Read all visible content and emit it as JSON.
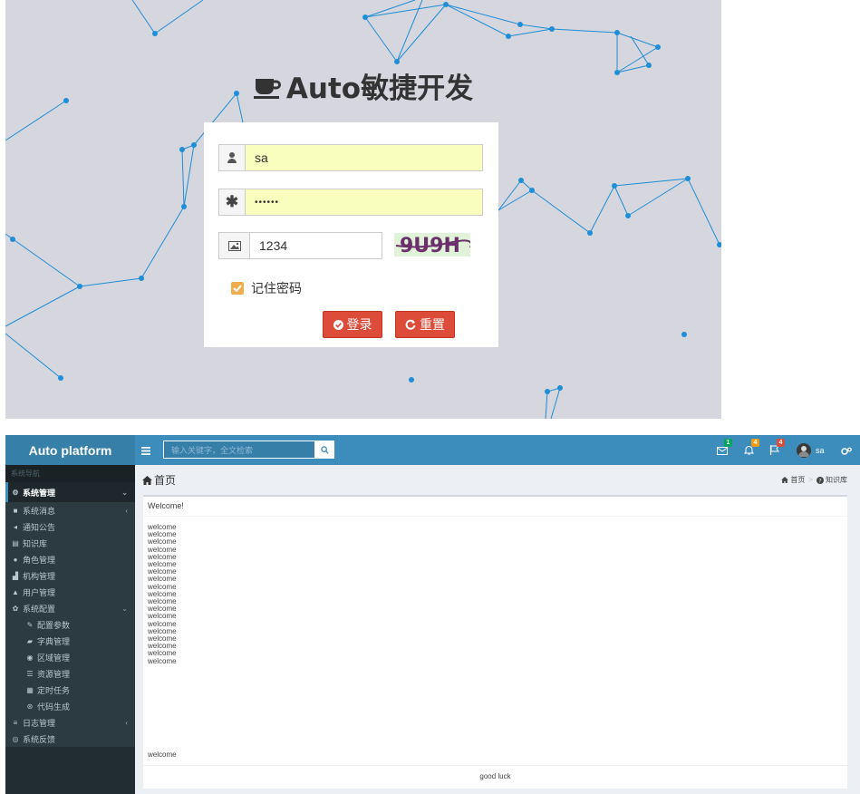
{
  "login": {
    "title": "Auto敏捷开发",
    "username_value": "sa",
    "password_value": "••••••",
    "captcha_input_value": "1234",
    "captcha_image_text": "9U9H",
    "remember_label": "记住密码",
    "login_button": "登录",
    "reset_button": "重置"
  },
  "admin": {
    "logo": "Auto platform",
    "search_placeholder": "输入关键字，全文检索",
    "header_badges": {
      "messages": "1",
      "notifications": "4",
      "tasks": "4"
    },
    "user_name": "sa",
    "sidebar": {
      "header": "系统导航",
      "items": [
        {
          "label": "系统管理",
          "icon": "cogs-icon",
          "active": true,
          "arrow": "⌄"
        },
        {
          "label": "系统消息",
          "icon": "folder-icon",
          "arrow": "‹"
        },
        {
          "label": "通知公告",
          "icon": "bullhorn-icon"
        },
        {
          "label": "知识库",
          "icon": "book-icon"
        },
        {
          "label": "角色管理",
          "icon": "users-icon"
        },
        {
          "label": "机构管理",
          "icon": "sitemap-icon"
        },
        {
          "label": "用户管理",
          "icon": "user-icon"
        },
        {
          "label": "系统配置",
          "icon": "gear-icon",
          "arrow": "⌄"
        },
        {
          "label": "配置参数",
          "icon": "wrench-icon"
        },
        {
          "label": "字典管理",
          "icon": "book-icon"
        },
        {
          "label": "区域管理",
          "icon": "globe-icon"
        },
        {
          "label": "资源管理",
          "icon": "list-icon"
        },
        {
          "label": "定时任务",
          "icon": "tasks-icon"
        },
        {
          "label": "代码生成",
          "icon": "code-icon"
        },
        {
          "label": "日志管理",
          "icon": "bars-icon",
          "arrow": "‹"
        },
        {
          "label": "系统反馈",
          "icon": "eye-icon"
        }
      ]
    },
    "page_title": "首页",
    "breadcrumb": {
      "home": "首页",
      "sep": ">",
      "current": "知识库"
    },
    "box_title": "Welcome!",
    "welcome_lines": [
      "welcome",
      "welcome",
      "welcome",
      "welcome",
      "welcome",
      "welcome",
      "welcome",
      "welcome",
      "welcome",
      "welcome",
      "welcome",
      "welcome",
      "welcome",
      "welcome",
      "welcome",
      "welcome",
      "welcome",
      "welcome",
      "welcome"
    ],
    "last_line": "welcome",
    "footer": "good luck"
  }
}
